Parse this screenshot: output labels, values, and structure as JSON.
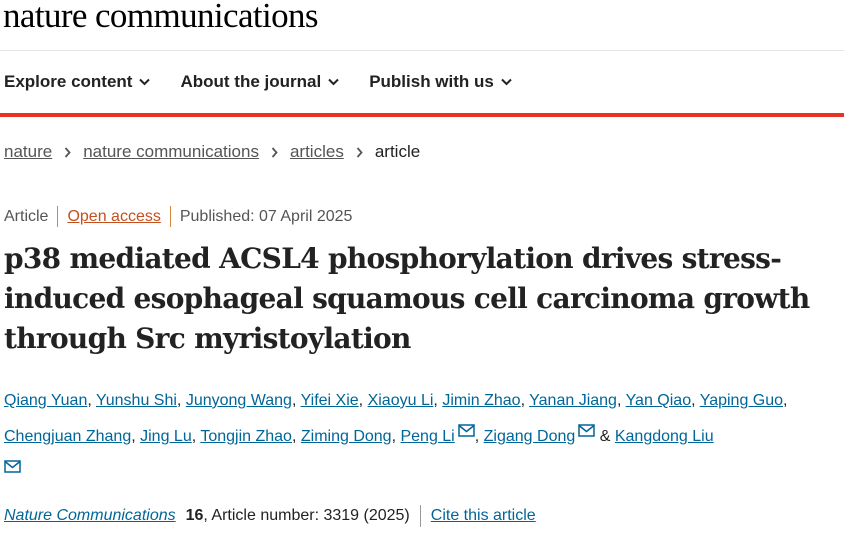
{
  "header": {
    "logo_text": "nature communications"
  },
  "nav": {
    "items": [
      {
        "label": "Explore content",
        "icon": "chevron-down-icon"
      },
      {
        "label": "About the journal",
        "icon": "chevron-down-icon"
      },
      {
        "label": "Publish with us",
        "icon": "chevron-down-icon"
      }
    ]
  },
  "colors": {
    "accent_red": "#e63323",
    "link": "#006699",
    "open_access": "#c4501e"
  },
  "breadcrumb": {
    "items": [
      "nature",
      "nature communications",
      "articles"
    ],
    "current": "article",
    "separator_icon": "chevron-right-icon"
  },
  "article": {
    "type": "Article",
    "access": "Open access",
    "published": "Published: 07 April 2025",
    "title": "p38 mediated ACSL4 phosphorylation drives stress-induced esophageal squamous cell carcinoma growth through Src myristoylation"
  },
  "authors": {
    "list": [
      "Qiang Yuan",
      "Yunshu Shi",
      "Junyong Wang",
      "Yifei Xie",
      "Xiaoyu Li",
      "Jimin Zhao",
      "Yanan Jiang",
      "Yan Qiao",
      "Yaping Guo",
      "Chengjuan Zhang",
      "Jing Lu",
      "Tongjin Zhao",
      "Ziming Dong",
      "Peng Li",
      "Zigang Dong",
      "Kangdong Liu"
    ],
    "separator": ",",
    "and": "&",
    "mail_icon": "mail-icon"
  },
  "citation": {
    "journal": "Nature Communications",
    "volume": "16",
    "article_number": ", Article number: 3319 (2025)",
    "cite_link": "Cite this article"
  }
}
